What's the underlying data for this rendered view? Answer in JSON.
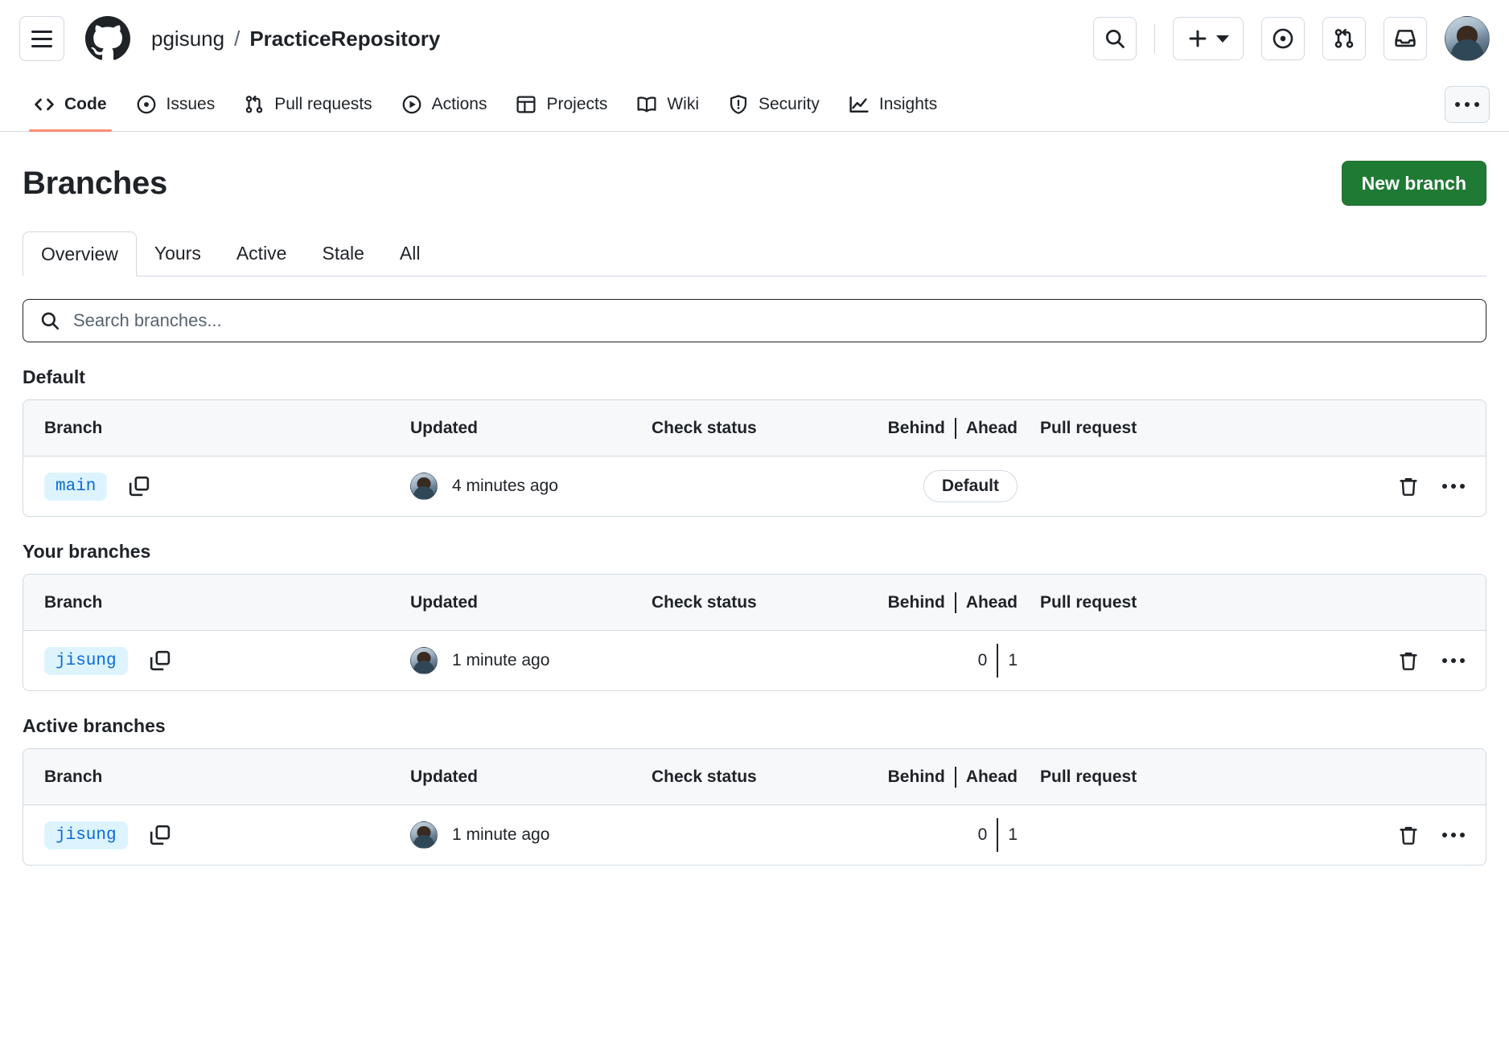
{
  "header": {
    "menu_label": "Open menu",
    "logo": "github-logo",
    "breadcrumb": {
      "owner": "pgisung",
      "separator": "/",
      "repo": "PracticeRepository"
    },
    "actions": [
      {
        "name": "search-button",
        "icon": "search-icon"
      },
      {
        "name": "create-new-button",
        "icon": "plus-icon"
      },
      {
        "name": "issues-button",
        "icon": "issue-opened-icon"
      },
      {
        "name": "pull-requests-button",
        "icon": "git-pull-request-icon"
      },
      {
        "name": "notifications-button",
        "icon": "inbox-icon"
      },
      {
        "name": "user-avatar",
        "icon": "avatar-icon"
      }
    ]
  },
  "repo_nav": {
    "items": [
      {
        "label": "Code",
        "icon": "code-icon",
        "active": true
      },
      {
        "label": "Issues",
        "icon": "issue-opened-icon",
        "active": false
      },
      {
        "label": "Pull requests",
        "icon": "git-pull-request-icon",
        "active": false
      },
      {
        "label": "Actions",
        "icon": "play-icon",
        "active": false
      },
      {
        "label": "Projects",
        "icon": "table-icon",
        "active": false
      },
      {
        "label": "Wiki",
        "icon": "book-icon",
        "active": false
      },
      {
        "label": "Security",
        "icon": "shield-icon",
        "active": false
      },
      {
        "label": "Insights",
        "icon": "graph-icon",
        "active": false
      }
    ],
    "more_label": "More"
  },
  "page": {
    "title": "Branches",
    "new_branch_label": "New branch"
  },
  "filter_tabs": [
    {
      "label": "Overview",
      "active": true
    },
    {
      "label": "Yours",
      "active": false
    },
    {
      "label": "Active",
      "active": false
    },
    {
      "label": "Stale",
      "active": false
    },
    {
      "label": "All",
      "active": false
    }
  ],
  "search": {
    "placeholder": "Search branches...",
    "value": "",
    "icon": "search-icon"
  },
  "columns": {
    "branch": "Branch",
    "updated": "Updated",
    "check_status": "Check status",
    "behind": "Behind",
    "ahead": "Ahead",
    "pull_request": "Pull request"
  },
  "sections": [
    {
      "title": "Default",
      "rows": [
        {
          "branch": "main",
          "updated": "4 minutes ago",
          "check_status": "",
          "behind": "",
          "ahead": "",
          "badge": "Default",
          "pull_request": "",
          "has_counts": false
        }
      ]
    },
    {
      "title": "Your branches",
      "rows": [
        {
          "branch": "jisung",
          "updated": "1 minute ago",
          "check_status": "",
          "behind": "0",
          "ahead": "1",
          "badge": "",
          "pull_request": "",
          "has_counts": true
        }
      ]
    },
    {
      "title": "Active branches",
      "rows": [
        {
          "branch": "jisung",
          "updated": "1 minute ago",
          "check_status": "",
          "behind": "0",
          "ahead": "1",
          "badge": "",
          "pull_request": "",
          "has_counts": true
        }
      ]
    }
  ],
  "row_actions": {
    "delete_label": "Delete branch",
    "more_label": "More options",
    "copy_label": "Copy branch name"
  },
  "colors": {
    "accent_green": "#1f7a33",
    "branch_pill_bg": "#ddf4ff",
    "branch_pill_fg": "#0969da",
    "header_row_bg": "#f6f8fa",
    "border": "#d1d9e0",
    "active_tab_underline": "#fd8c73"
  }
}
